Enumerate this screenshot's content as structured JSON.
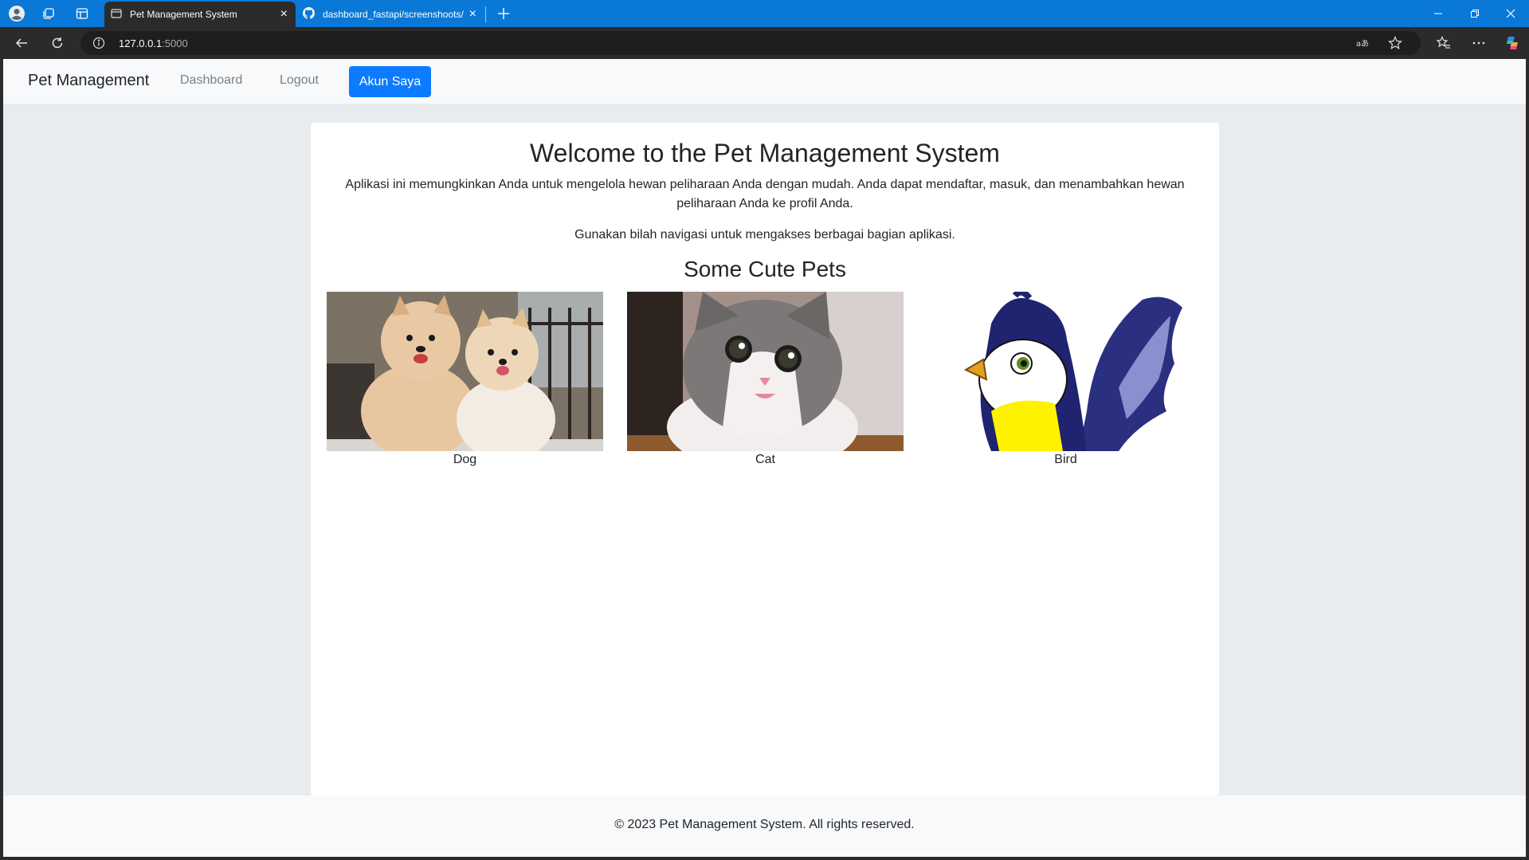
{
  "browser": {
    "tabs": [
      {
        "title": "Pet Management System",
        "active": true
      },
      {
        "title": "dashboard_fastapi/screenshoots/",
        "active": false
      }
    ],
    "address": {
      "host": "127.0.0.1",
      "port": ":5000"
    }
  },
  "navbar": {
    "brand": "Pet Management",
    "links": [
      "Dashboard",
      "Logout"
    ],
    "account_button": "Akun Saya"
  },
  "main": {
    "title": "Welcome to the Pet Management System",
    "intro": "Aplikasi ini memungkinkan Anda untuk mengelola hewan peliharaan Anda dengan mudah. Anda dapat mendaftar, masuk, dan menambahkan hewan peliharaan Anda ke profil Anda.",
    "hint": "Gunakan bilah navigasi untuk mengakses berbagai bagian aplikasi.",
    "pets_heading": "Some Cute Pets",
    "pets": [
      {
        "label": "Dog"
      },
      {
        "label": "Cat"
      },
      {
        "label": "Bird"
      }
    ]
  },
  "footer": {
    "text": "© 2023 Pet Management System. All rights reserved."
  },
  "colors": {
    "tabstrip": "#0a78d7",
    "primary_button": "#0d7bff",
    "page_background": "#e9ecef",
    "navbar_background": "#f8f9fa"
  }
}
